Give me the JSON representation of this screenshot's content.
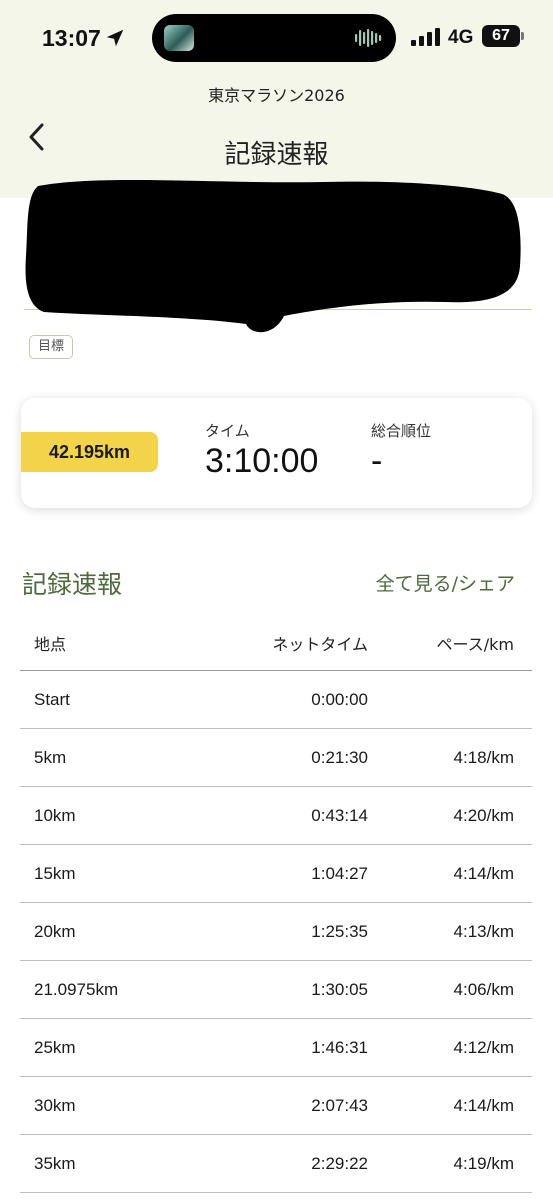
{
  "status_bar": {
    "time": "13:07",
    "network": "4G",
    "battery": "67"
  },
  "header": {
    "event_title": "東京マラソン2026",
    "page_title": "記録速報"
  },
  "goal_tag": "目標",
  "summary": {
    "distance": "42.195km",
    "time_label": "タイム",
    "time_value": "3:10:00",
    "rank_label": "総合順位",
    "rank_value": "-"
  },
  "records": {
    "heading": "記録速報",
    "see_all": "全て見る/シェア",
    "columns": [
      "地点",
      "ネットタイム",
      "ペース/km"
    ],
    "rows": [
      {
        "point": "Start",
        "net": "0:00:00",
        "pace": ""
      },
      {
        "point": "5km",
        "net": "0:21:30",
        "pace": "4:18/km"
      },
      {
        "point": "10km",
        "net": "0:43:14",
        "pace": "4:20/km"
      },
      {
        "point": "15km",
        "net": "1:04:27",
        "pace": "4:14/km"
      },
      {
        "point": "20km",
        "net": "1:25:35",
        "pace": "4:13/km"
      },
      {
        "point": "21.0975km",
        "net": "1:30:05",
        "pace": "4:06/km"
      },
      {
        "point": "25km",
        "net": "1:46:31",
        "pace": "4:12/km"
      },
      {
        "point": "30km",
        "net": "2:07:43",
        "pace": "4:14/km"
      },
      {
        "point": "35km",
        "net": "2:29:22",
        "pace": "4:19/km"
      }
    ]
  },
  "colors": {
    "header_bg": "#f4f6ea",
    "accent_green": "#4d6b3b",
    "distance_badge": "#f3d34a"
  },
  "icons": [
    "location-arrow-icon",
    "soundwave-icon",
    "signal-bars-icon",
    "back-chevron-icon"
  ]
}
